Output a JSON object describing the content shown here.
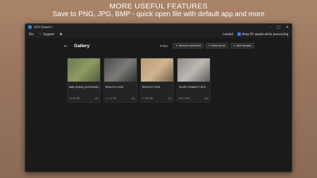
{
  "promo": {
    "headline": "MORE USEFUL FEATURES",
    "subline": "Save to PNG, JPG, BMP - quick open file with default app and more"
  },
  "window": {
    "title": "UCR Viewer+",
    "controls": {
      "minimize": "–",
      "maximize": "□",
      "close": "✕"
    }
  },
  "menu": {
    "file": "File",
    "support": "Support",
    "loaded": "Loaded",
    "keep_awake": "Keep PC awake while processing",
    "keep_awake_checked": true
  },
  "gallery": {
    "back": "←",
    "title": "Gallery",
    "count": "4 files",
    "remove_selected": "Remove selected",
    "remove_all": "Remove all",
    "add_images": "Add images",
    "files": [
      {
        "name": "RAW_KODAK_EASYSHARE_Z1015_IS.DCR",
        "size": "18.95 MB",
        "colors": [
          "#6b7a52",
          "#8c9a63",
          "#4c5a38"
        ]
      },
      {
        "name": "RP4A7577.DCR",
        "size": "11.12 MB",
        "colors": [
          "#4a4a4a",
          "#7b7b78",
          "#2e2e2e"
        ]
      },
      {
        "name": "RP4A7577.DCR",
        "size": "27.86 MB",
        "colors": [
          "#b79a76",
          "#d0b48f",
          "#6b5a46"
        ]
      },
      {
        "name": "SX-DFF-70566477.DCR",
        "size": "88.22 MB",
        "colors": [
          "#8d8a86",
          "#bcb8b2",
          "#5b5956"
        ]
      }
    ]
  }
}
